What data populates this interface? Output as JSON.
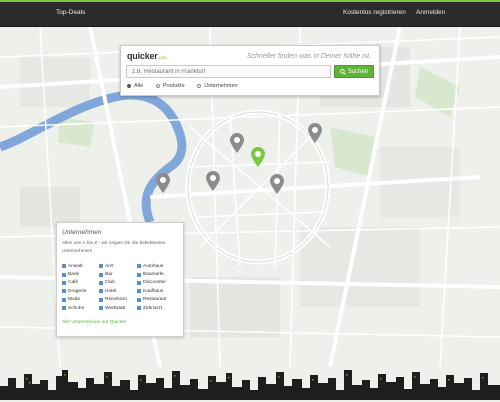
{
  "header": {
    "top_deals": "Top-Deals",
    "register": "Kostenlos registrieren",
    "login": "Anmelden"
  },
  "search": {
    "logo_text": "quicker",
    "logo_suffix": ".com",
    "tagline": "Schneller finden was in Deiner Nähe ist.",
    "placeholder": "z.B. Restaurant in Frankfurt",
    "button_label": "Suchen",
    "filters": [
      {
        "label": "Alle",
        "checked": true
      },
      {
        "label": "Produkte",
        "checked": false
      },
      {
        "label": "Unternehmen",
        "checked": false
      }
    ]
  },
  "map": {
    "pins": [
      {
        "id": "pin-1",
        "highlighted": false
      },
      {
        "id": "pin-2",
        "highlighted": false
      },
      {
        "id": "pin-3",
        "highlighted": true
      },
      {
        "id": "pin-4",
        "highlighted": false
      },
      {
        "id": "pin-5",
        "highlighted": false
      },
      {
        "id": "pin-6",
        "highlighted": false
      }
    ]
  },
  "directory": {
    "title": "Unternehmen",
    "description": "Alles von A bis Z - wir zeigen Dir die beliebtesten Unternehmen!",
    "columns": [
      [
        "Anwalt",
        "Bank",
        "Café",
        "Drogerie",
        "Mode",
        "Schuhe"
      ],
      [
        "Arzt",
        "Bar",
        "Club",
        "Hotel",
        "Reisebüro",
        "Werkstatt"
      ],
      [
        "Autohaus",
        "Baumarkt",
        "Discounter",
        "Kaufhaus",
        "Restaurant",
        "Zahnarzt"
      ]
    ],
    "all_link": "Alle Unternehmen auf Quicker"
  },
  "colors": {
    "accent": "#7ac943",
    "button": "#5fb336",
    "topbar": "#2b2b2b",
    "river": "#7fa7d9",
    "pin_default": "#8c8c8c",
    "pin_highlight": "#7ac943",
    "category_icon": "#5a8ec7"
  }
}
